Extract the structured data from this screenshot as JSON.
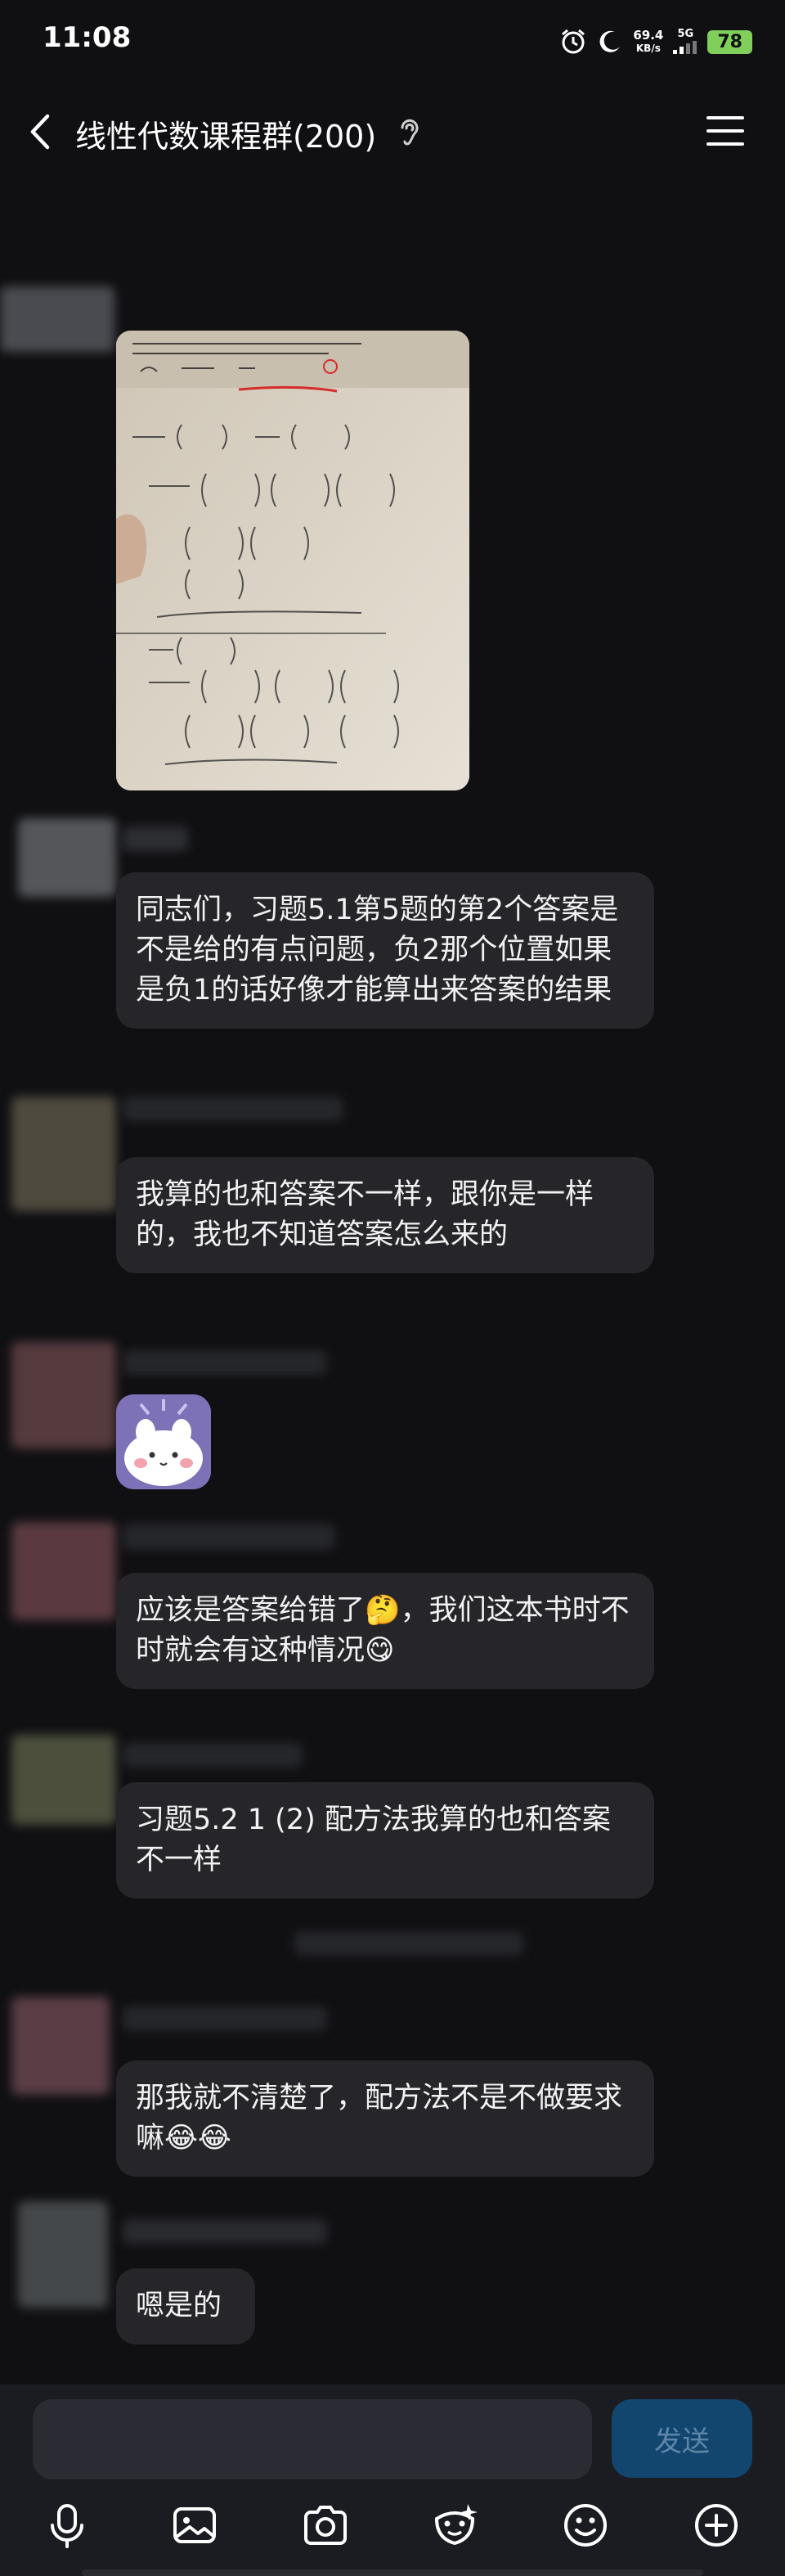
{
  "status_bar": {
    "time": "11:08",
    "net_speed_value": "69.4",
    "net_speed_unit": "KB/s",
    "signal_label": "5G",
    "battery": "78"
  },
  "header": {
    "title": "线性代数课程群(200)"
  },
  "messages": [
    {
      "type": "image"
    },
    {
      "type": "text",
      "text": "同志们，习题5.1第5题的第2个答案是不是给的有点问题，负2那个位置如果是负1的话好像才能算出来答案的结果"
    },
    {
      "type": "text",
      "text": "我算的也和答案不一样，跟你是一样的，我也不知道答案怎么来的"
    },
    {
      "type": "sticker"
    },
    {
      "type": "text",
      "text": "应该是答案给错了🤔，我们这本书时不时就会有这种情况😋"
    },
    {
      "type": "text",
      "text": "习题5.2 1 (2) 配方法我算的也和答案不一样"
    },
    {
      "type": "text",
      "text": "那我就不清楚了，配方法不是不做要求嘛😂😂"
    },
    {
      "type": "text",
      "text": "嗯是的"
    }
  ],
  "input": {
    "send_label": "发送"
  },
  "toolbar": {
    "icons": [
      "microphone-icon",
      "image-icon",
      "camera-icon",
      "face-mask-icon",
      "emoji-icon",
      "plus-icon"
    ]
  },
  "colors": {
    "background": "#101013",
    "bubble": "#26262a",
    "send_button": "#12466e",
    "battery": "#7fcf5a"
  }
}
